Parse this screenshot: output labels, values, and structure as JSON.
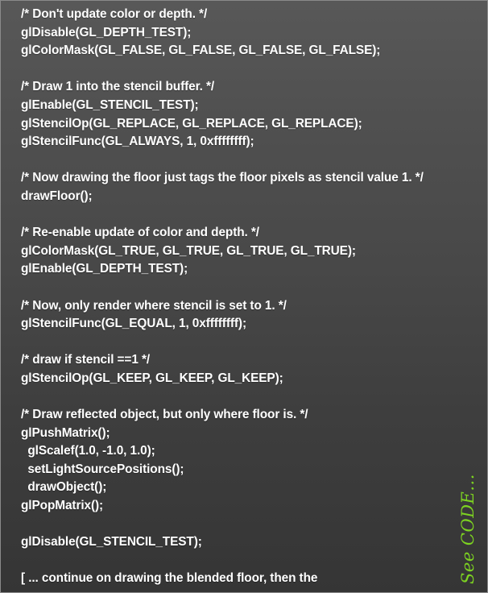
{
  "code_lines": [
    "/* Don't update color or depth. */",
    "glDisable(GL_DEPTH_TEST);",
    "glColorMask(GL_FALSE, GL_FALSE, GL_FALSE, GL_FALSE);",
    "",
    "/* Draw 1 into the stencil buffer. */",
    "glEnable(GL_STENCIL_TEST);",
    "glStencilOp(GL_REPLACE, GL_REPLACE, GL_REPLACE);",
    "glStencilFunc(GL_ALWAYS, 1, 0xffffffff);",
    "",
    "/* Now drawing the floor just tags the floor pixels as stencil value 1. */",
    "drawFloor();",
    "",
    "/* Re-enable update of color and depth. */",
    "glColorMask(GL_TRUE, GL_TRUE, GL_TRUE, GL_TRUE);",
    "glEnable(GL_DEPTH_TEST);",
    "",
    "/* Now, only render where stencil is set to 1. */",
    "glStencilFunc(GL_EQUAL, 1, 0xffffffff);",
    "",
    "/* draw if stencil ==1 */",
    "glStencilOp(GL_KEEP, GL_KEEP, GL_KEEP);",
    "",
    "/* Draw reflected object, but only where floor is. */",
    "glPushMatrix();",
    "  glScalef(1.0, -1.0, 1.0);",
    "  setLightSourcePositions();",
    "  drawObject();",
    "glPopMatrix();",
    "",
    "glDisable(GL_STENCIL_TEST);",
    "",
    "[ ... continue on drawing the blended floor, then the"
  ],
  "side_label": "See CODE...",
  "colors": {
    "text": "#ffffff",
    "accent": "#7dd321",
    "background_top": "#585858",
    "background_bottom": "#353535"
  }
}
